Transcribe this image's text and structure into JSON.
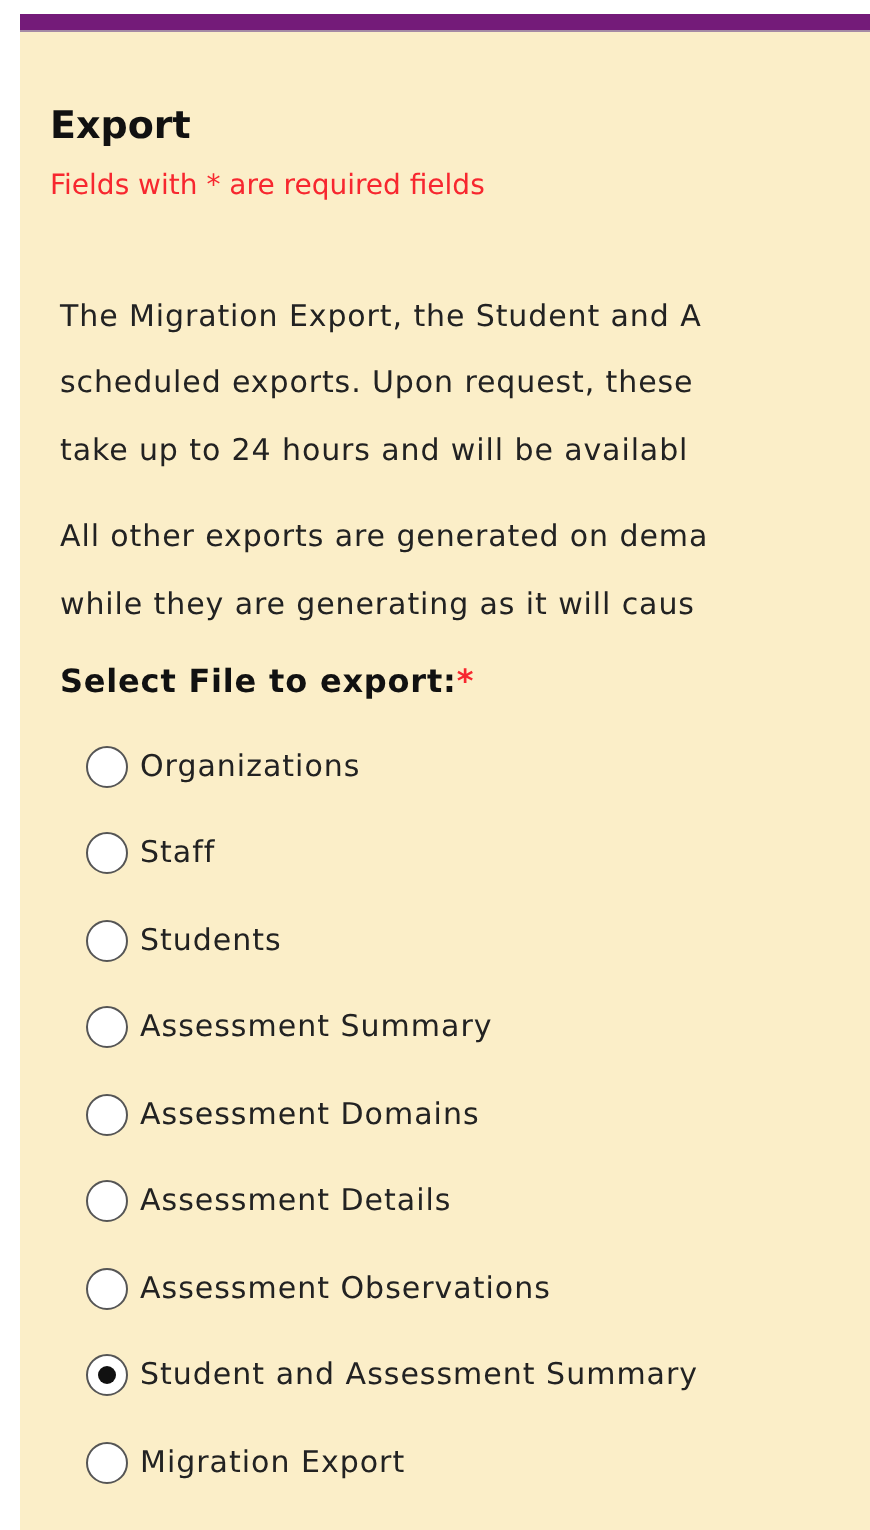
{
  "title": "Export",
  "required_note": "Fields with * are required fields",
  "paragraphs": [
    {
      "lines": [
        "The Migration Export, the Student and A",
        "scheduled exports. Upon request, these",
        "take up to 24 hours and will be availabl"
      ]
    },
    {
      "lines": [
        "All other exports are generated on dema",
        "while they are generating as it will caus"
      ]
    }
  ],
  "field_label": "Select File to export:",
  "required_mark": "*",
  "options": [
    {
      "label": "Organizations",
      "selected": false
    },
    {
      "label": "Staff",
      "selected": false
    },
    {
      "label": "Students",
      "selected": false
    },
    {
      "label": "Assessment Summary",
      "selected": false
    },
    {
      "label": "Assessment Domains",
      "selected": false
    },
    {
      "label": "Assessment Details",
      "selected": false
    },
    {
      "label": "Assessment Observations",
      "selected": false
    },
    {
      "label": "Student and Assessment Summary",
      "selected": true
    },
    {
      "label": "Migration Export",
      "selected": false
    }
  ]
}
